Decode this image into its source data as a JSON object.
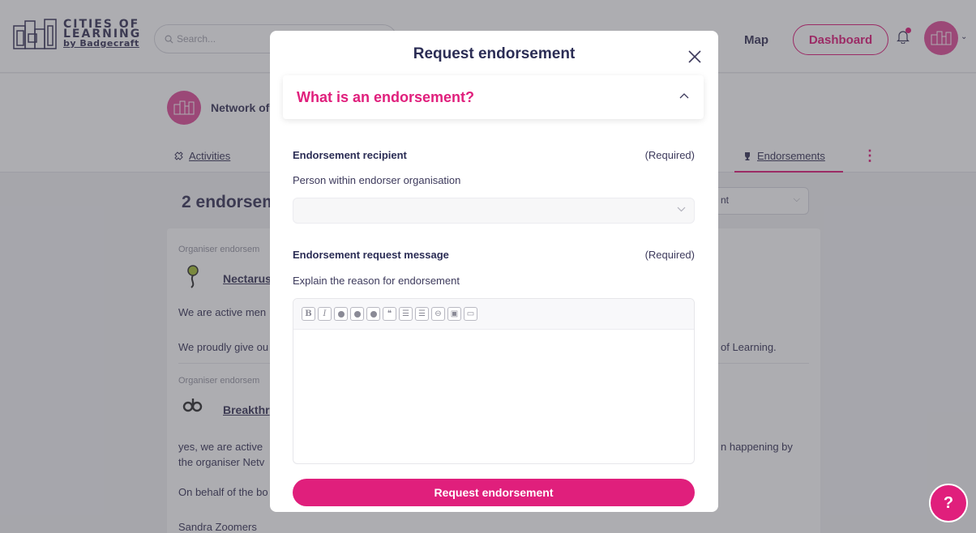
{
  "header": {
    "logo_line1": "CITIES OF",
    "logo_line2": "LEARNING",
    "logo_line3": "by Badgecraft",
    "search_placeholder": "Search...",
    "nav_map": "Map",
    "dashboard_label": "Dashboard"
  },
  "org": {
    "name": "Network of",
    "tabs": {
      "activities": "Activities",
      "endorsements": "Endorsements"
    }
  },
  "main": {
    "section_title": "2 endorsem",
    "sort_value": "nt"
  },
  "endorsement_list": [
    {
      "type_label": "Organiser endorsem",
      "name": "Nectarus",
      "line1": "We are active men",
      "line2_left": "We proudly give ou",
      "line2_right": "of Learning."
    },
    {
      "type_label": "Organiser endorsem",
      "name": "Breakthr",
      "line1_left": "yes, we are active",
      "line1_right": "n happening by",
      "line2": "the organiser Netv",
      "line3": "On behalf of the bo",
      "line4": "Sandra Zoomers"
    }
  ],
  "modal": {
    "title": "Request endorsement",
    "accordion_title": "What is an endorsement?",
    "recipient": {
      "label": "Endorsement recipient",
      "required": "(Required)",
      "hint": "Person within endorser organisation",
      "value": ""
    },
    "message": {
      "label": "Endorsement request message",
      "required": "(Required)",
      "hint": "Explain the reason for endorsement",
      "value": ""
    },
    "toolbar_icons": [
      "bold-icon",
      "italic-icon",
      "heading-1-icon",
      "heading-2-icon",
      "heading-3-icon",
      "quote-icon",
      "bullet-list-icon",
      "numbered-list-icon",
      "link-icon",
      "image-icon",
      "video-icon"
    ],
    "submit_label": "Request endorsement"
  },
  "help_label": "?",
  "colors": {
    "brand": "#e01f7c",
    "text_dark": "#2b2d55"
  }
}
